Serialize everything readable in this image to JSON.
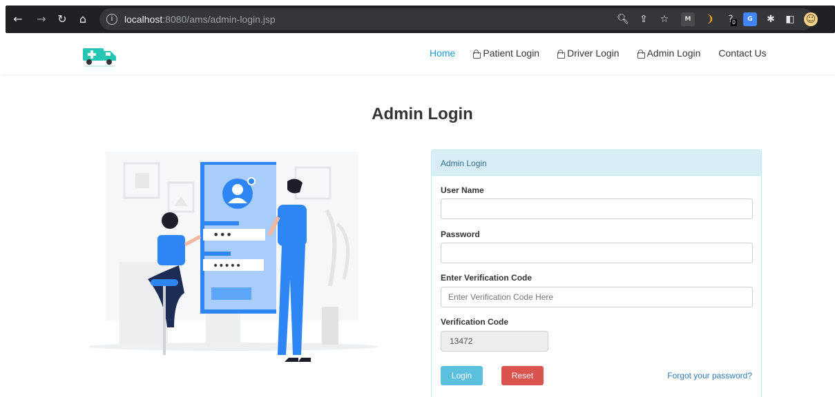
{
  "browser": {
    "url_host": "localhost",
    "url_path": ":8080/ams/admin-login.jsp",
    "info_glyph": "i",
    "nav_icons": [
      "back-arrow-icon",
      "forward-arrow-icon",
      "reload-icon",
      "home-icon"
    ],
    "toolbar_icons": [
      "zoom-icon",
      "share-icon",
      "star-icon",
      "ext-m-icon",
      "ext-orange-icon",
      "ext-question-icon",
      "ext-translate-icon",
      "puzzle-icon",
      "sidepanel-icon",
      "profile-avatar-icon"
    ],
    "ext_badge": "0",
    "ext_m": "M"
  },
  "nav": {
    "items": [
      {
        "label": "Home",
        "lock": false,
        "active": true
      },
      {
        "label": "Patient Login",
        "lock": true,
        "active": false
      },
      {
        "label": "Driver Login",
        "lock": true,
        "active": false
      },
      {
        "label": "Admin Login",
        "lock": true,
        "active": false
      },
      {
        "label": "Contact Us",
        "lock": false,
        "active": false
      }
    ]
  },
  "page": {
    "title": "Admin Login"
  },
  "illustration": {
    "password_dots_1": "•••",
    "password_dots_2": "•••••"
  },
  "panel": {
    "heading": "Admin Login",
    "username_label": "User Name",
    "username_value": "",
    "password_label": "Password",
    "password_value": "",
    "verify_label": "Enter Verification Code",
    "verify_placeholder": "Enter Verification Code Here",
    "code_label": "Verification Code",
    "code_value": "13472",
    "login_label": "Login",
    "reset_label": "Reset",
    "forgot_label": "Forgot your password?"
  },
  "colors": {
    "brand": "#26c6b5",
    "active_link": "#1b9bd1",
    "panel_heading_bg": "#d9edf7",
    "login_btn": "#5bc0de",
    "reset_btn": "#d9534f",
    "illustration_blue": "#2e86f5"
  }
}
